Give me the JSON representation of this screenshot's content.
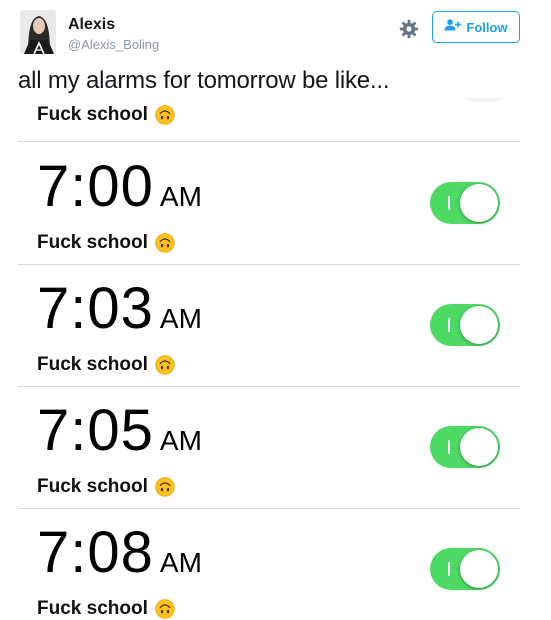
{
  "tweet": {
    "user": {
      "name": "Alexis",
      "handle": "@Alexis_Boling"
    },
    "actions": {
      "follow_label": "Follow"
    },
    "text": "all my alarms for tomorrow be like..."
  },
  "alarms_screen": {
    "partial_label": "Fuck school",
    "alarms": [
      {
        "time": "7:00",
        "period": "AM",
        "label": "Fuck school",
        "enabled": true
      },
      {
        "time": "7:03",
        "period": "AM",
        "label": "Fuck school",
        "enabled": true
      },
      {
        "time": "7:05",
        "period": "AM",
        "label": "Fuck school",
        "enabled": true
      },
      {
        "time": "7:08",
        "period": "AM",
        "label": "Fuck school",
        "enabled": true
      }
    ]
  },
  "colors": {
    "twitter_blue": "#1da1f2",
    "toggle_on": "#4cd964",
    "emoji_face": "#fcc21b",
    "handle_gray": "#8899a6"
  },
  "icons": [
    "avatar-photo",
    "gear-icon",
    "add-user-icon",
    "upside-down-face-emoji"
  ]
}
